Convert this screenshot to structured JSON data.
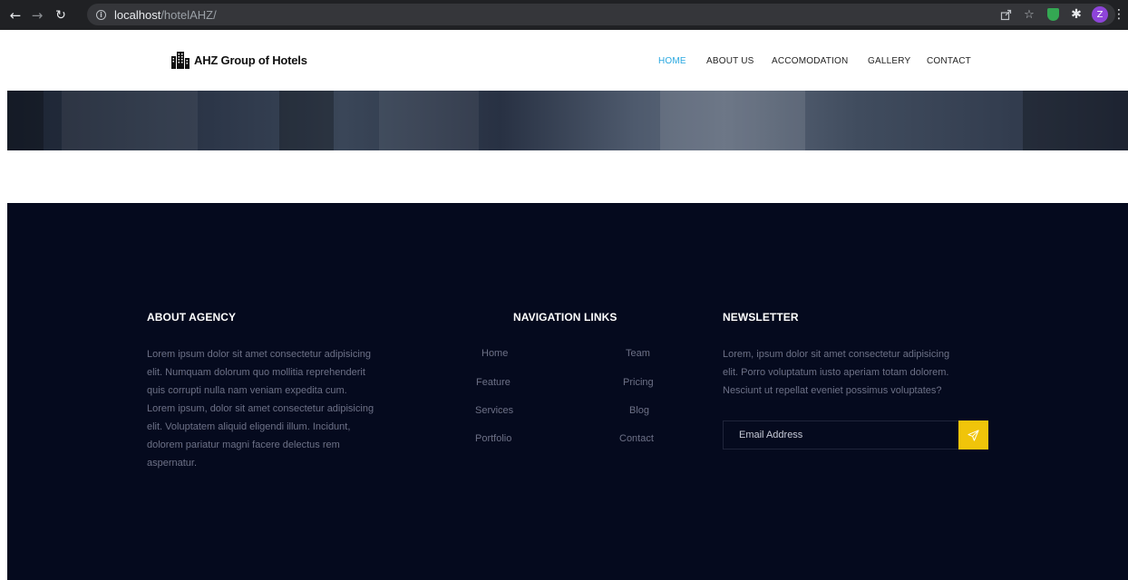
{
  "browser": {
    "url_host": "localhost",
    "url_path": "/hotelAHZ/",
    "profile_initial": "Z"
  },
  "header": {
    "logo_text": "AHZ Group of Hotels",
    "nav": [
      {
        "label": "HOME",
        "active": true
      },
      {
        "label": "ABOUT US",
        "active": false
      },
      {
        "label": "ACCOMODATION",
        "active": false
      },
      {
        "label": "GALLERY",
        "active": false
      },
      {
        "label": "CONTACT",
        "active": false
      }
    ],
    "active_color": "#28a8e0"
  },
  "footer": {
    "about": {
      "heading": "ABOUT AGENCY",
      "lines": [
        "Lorem ipsum dolor sit amet consectetur adipisicing",
        "elit. Numquam dolorum quo mollitia reprehenderit",
        "quis corrupti nulla nam veniam expedita cum.",
        "Lorem ipsum, dolor sit amet consectetur adipisicing",
        "elit. Voluptatem aliquid eligendi illum. Incidunt,",
        "dolorem pariatur magni facere delectus rem",
        "aspernatur."
      ]
    },
    "navigation": {
      "heading": "NAVIGATION LINKS",
      "left_links": [
        "Home",
        "Feature",
        "Services",
        "Portfolio"
      ],
      "right_links": [
        "Team",
        "Pricing",
        "Blog",
        "Contact"
      ]
    },
    "newsletter": {
      "heading": "NEWSLETTER",
      "lines": [
        "Lorem, ipsum dolor sit amet consectetur adipisicing",
        "elit. Porro voluptatum iusto aperiam totam dolorem.",
        "Nesciunt ut repellat eveniet possimus voluptates?"
      ],
      "email_placeholder": "Email Address",
      "button_color": "#f0c40a"
    },
    "background_color": "#050a1e"
  }
}
